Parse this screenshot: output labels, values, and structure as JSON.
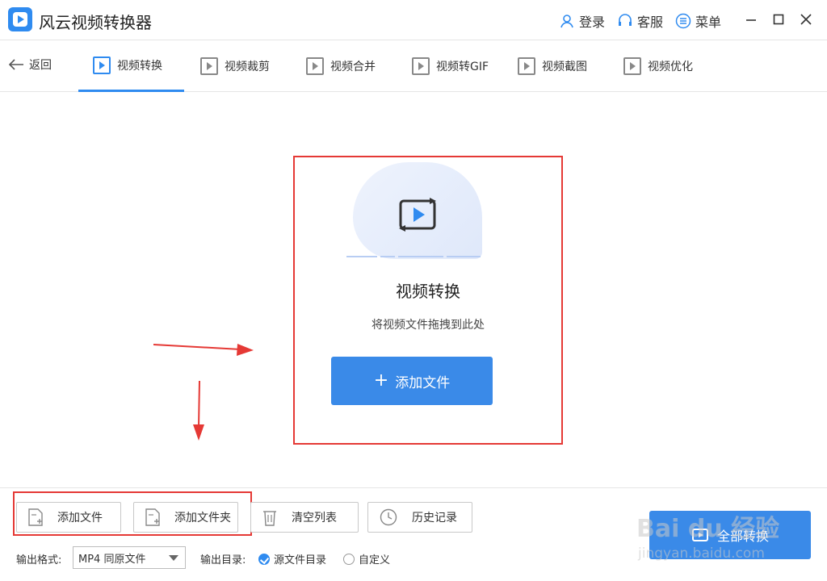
{
  "app": {
    "title": "风云视频转换器",
    "login_label": "登录",
    "service_label": "客服",
    "menu_label": "菜单"
  },
  "nav": {
    "back_label": "返回",
    "tabs": [
      {
        "label": "视频转换",
        "active": true
      },
      {
        "label": "视频裁剪"
      },
      {
        "label": "视频合并"
      },
      {
        "label": "视频转GIF"
      },
      {
        "label": "视频截图"
      },
      {
        "label": "视频优化"
      }
    ]
  },
  "dropzone": {
    "title": "视频转换",
    "hint": "将视频文件拖拽到此处",
    "add_button": "添加文件"
  },
  "toolbar": {
    "add_file": "添加文件",
    "add_folder": "添加文件夹",
    "clear_list": "清空列表",
    "history": "历史记录"
  },
  "output": {
    "format_label": "输出格式:",
    "format_value": "MP4 同原文件",
    "dir_label": "输出目录:",
    "dir_options": [
      {
        "label": "源文件目录",
        "selected": true
      },
      {
        "label": "自定义",
        "selected": false
      }
    ]
  },
  "convert_all": "全部转换",
  "watermark": {
    "line1": "Bai du 经验",
    "line2": "jingyan.baidu.com"
  },
  "colors": {
    "accent": "#3a8ae8",
    "highlight": "#e53935"
  }
}
